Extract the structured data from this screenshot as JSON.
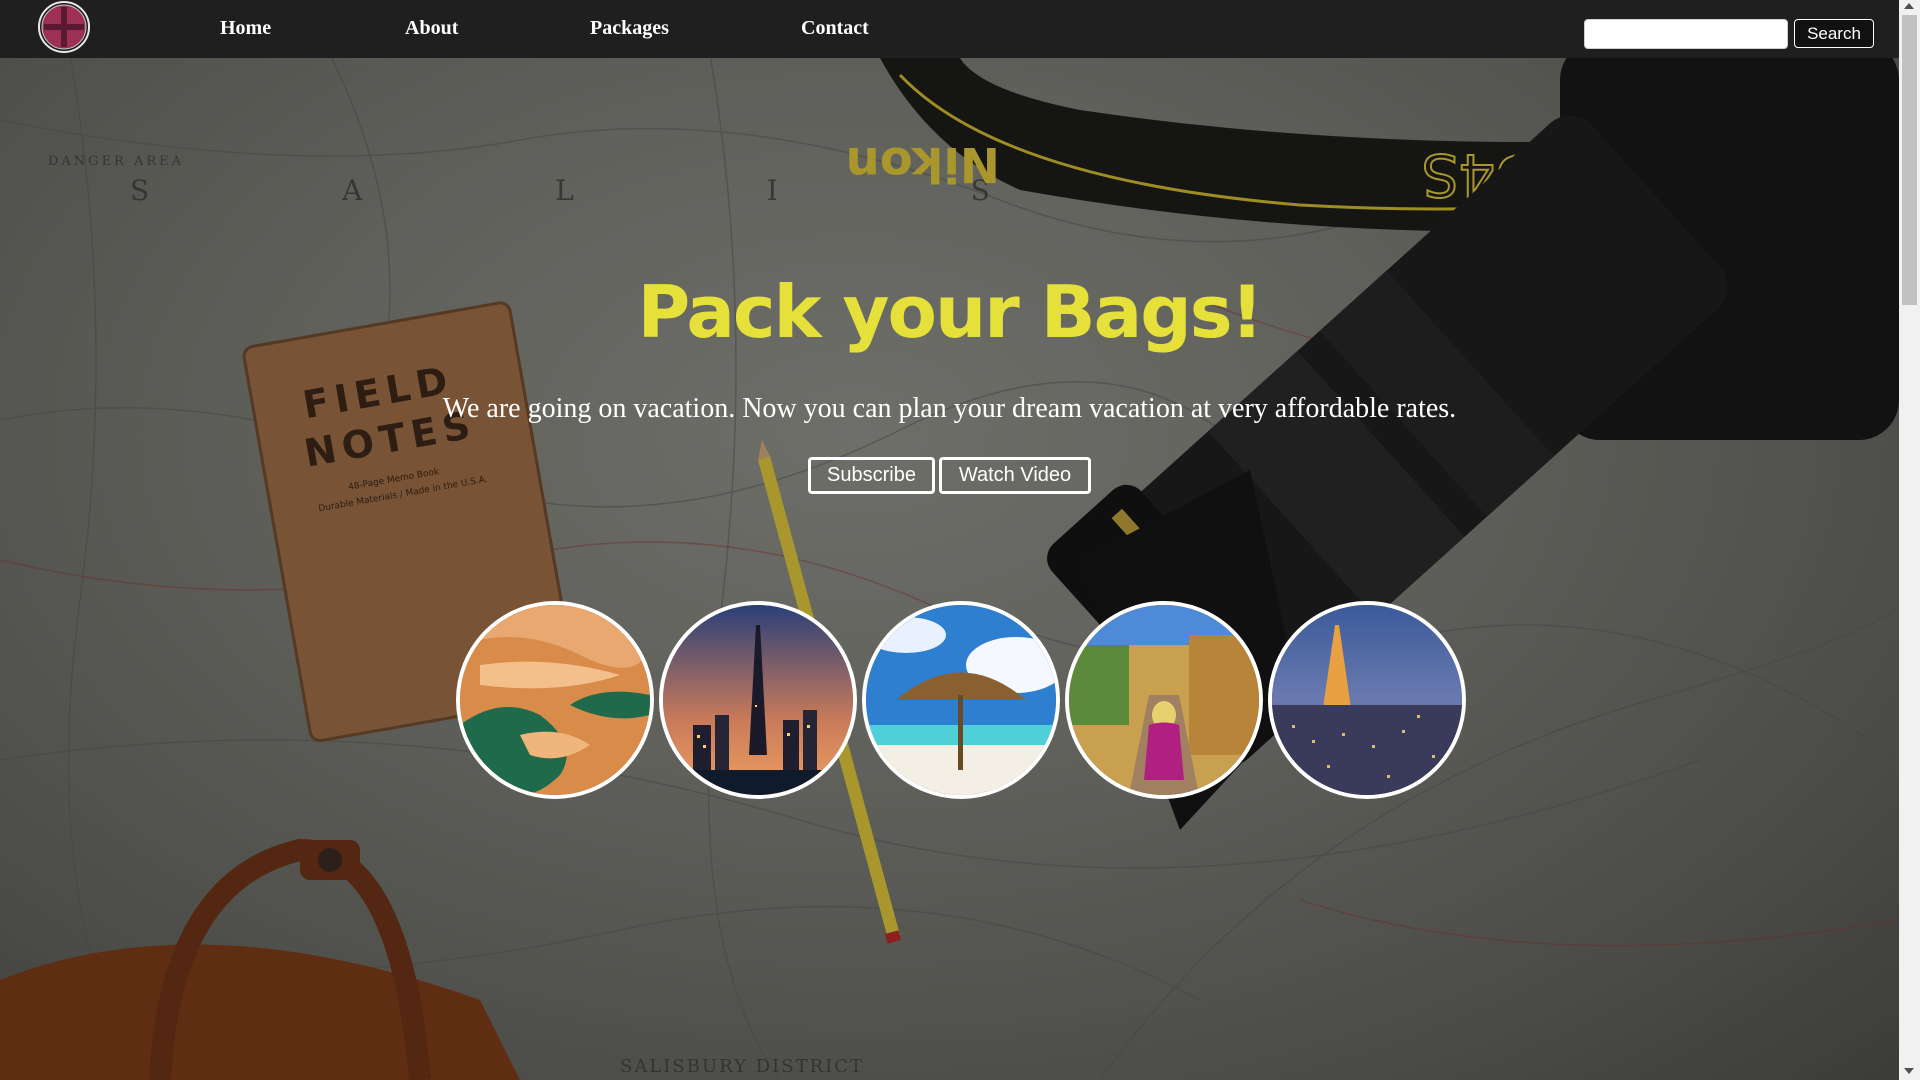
{
  "nav": {
    "logo_icon": "red-cross-globe-logo-icon",
    "links": [
      "Home",
      "About",
      "Packages",
      "Contact"
    ],
    "search": {
      "placeholder": "",
      "value": "",
      "button_label": "Search"
    }
  },
  "hero": {
    "title": "Pack your Bags!",
    "subtitle": "We are going on vacation. Now you can plan your dream vacation at very affordable rates.",
    "buttons": [
      "Subscribe",
      "Watch Video"
    ]
  },
  "destinations": [
    {
      "icon": "canyon-river-photo"
    },
    {
      "icon": "city-skyline-tower-photo"
    },
    {
      "icon": "beach-umbrella-photo"
    },
    {
      "icon": "palace-stairs-traveler-photo"
    },
    {
      "icon": "eiffel-tower-city-photo"
    }
  ],
  "background": {
    "map_lettering": [
      "DANGER AREA",
      "S A L I S B",
      "SALISBURY DISTRICT"
    ],
    "notebook_lettering": [
      "FIELD",
      "NOTES",
      "48-Page Memo Book",
      "Durable Materials / Made in the U.S.A."
    ],
    "strap_lettering": [
      "Nikon",
      "D4S"
    ]
  },
  "colors": {
    "nav_bg": "#1f1f1f",
    "title": "#e6e03a",
    "text": "#ffffff"
  }
}
